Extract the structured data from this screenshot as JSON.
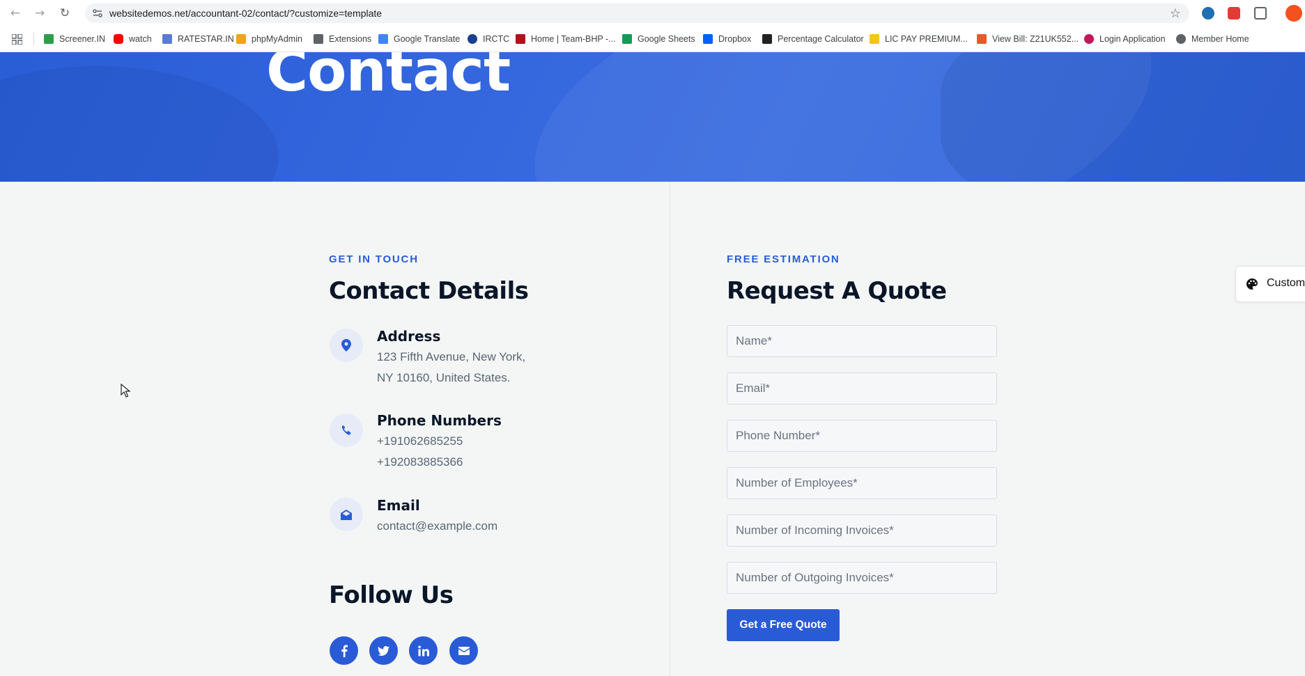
{
  "browser": {
    "url": "websitedemos.net/accountant-02/contact/?customize=template",
    "bookmarks": [
      {
        "label": "Screener.IN",
        "color": "#2e9d4a"
      },
      {
        "label": "watch",
        "color": "#ff0000"
      },
      {
        "label": "RATESTAR.IN",
        "color": "#5b7bd5"
      },
      {
        "label": "phpMyAdmin",
        "color": "#f0a41b"
      },
      {
        "label": "Extensions",
        "color": "#5f6368"
      },
      {
        "label": "Google Translate",
        "color": "#4285f4"
      },
      {
        "label": "IRCTC",
        "color": "#1d3f8f"
      },
      {
        "label": "Home | Team-BHP -...",
        "color": "#b3121d"
      },
      {
        "label": "Google Sheets",
        "color": "#0f9d58"
      },
      {
        "label": "Dropbox",
        "color": "#0061ff"
      },
      {
        "label": "Percentage Calculator",
        "color": "#222222"
      },
      {
        "label": "LIC PAY PREMIUM...",
        "color": "#f5c518"
      },
      {
        "label": "View Bill: Z21UK552...",
        "color": "#e65a2f"
      },
      {
        "label": "Login Application",
        "color": "#c2185b"
      },
      {
        "label": "Member Home",
        "color": "#5f6368"
      }
    ]
  },
  "hero": {
    "title": "Contact"
  },
  "contact": {
    "eyebrow": "GET IN TOUCH",
    "heading": "Contact Details",
    "address": {
      "title": "Address",
      "line1": "123 Fifth Avenue, New York,",
      "line2": "NY 10160, United States."
    },
    "phone": {
      "title": "Phone Numbers",
      "line1": "+191062685255",
      "line2": "+192083885366"
    },
    "email": {
      "title": "Email",
      "line1": "contact@example.com"
    },
    "follow_heading": "Follow Us",
    "socials": [
      "facebook-icon",
      "twitter-icon",
      "linkedin-icon",
      "envelope-icon"
    ]
  },
  "quote": {
    "eyebrow": "FREE ESTIMATION",
    "heading": "Request A Quote",
    "fields": {
      "name": "Name*",
      "email": "Email*",
      "phone": "Phone Number*",
      "employees": "Number of Employees*",
      "incoming": "Number of Incoming Invoices*",
      "outgoing": "Number of Outgoing Invoices*"
    },
    "button": "Get a Free Quote"
  },
  "customize_tab": {
    "label": "Custom"
  },
  "colors": {
    "accent": "#2a5bd7",
    "heading": "#0a1628",
    "body_text": "#5b6573",
    "background": "#f4f6f6"
  }
}
